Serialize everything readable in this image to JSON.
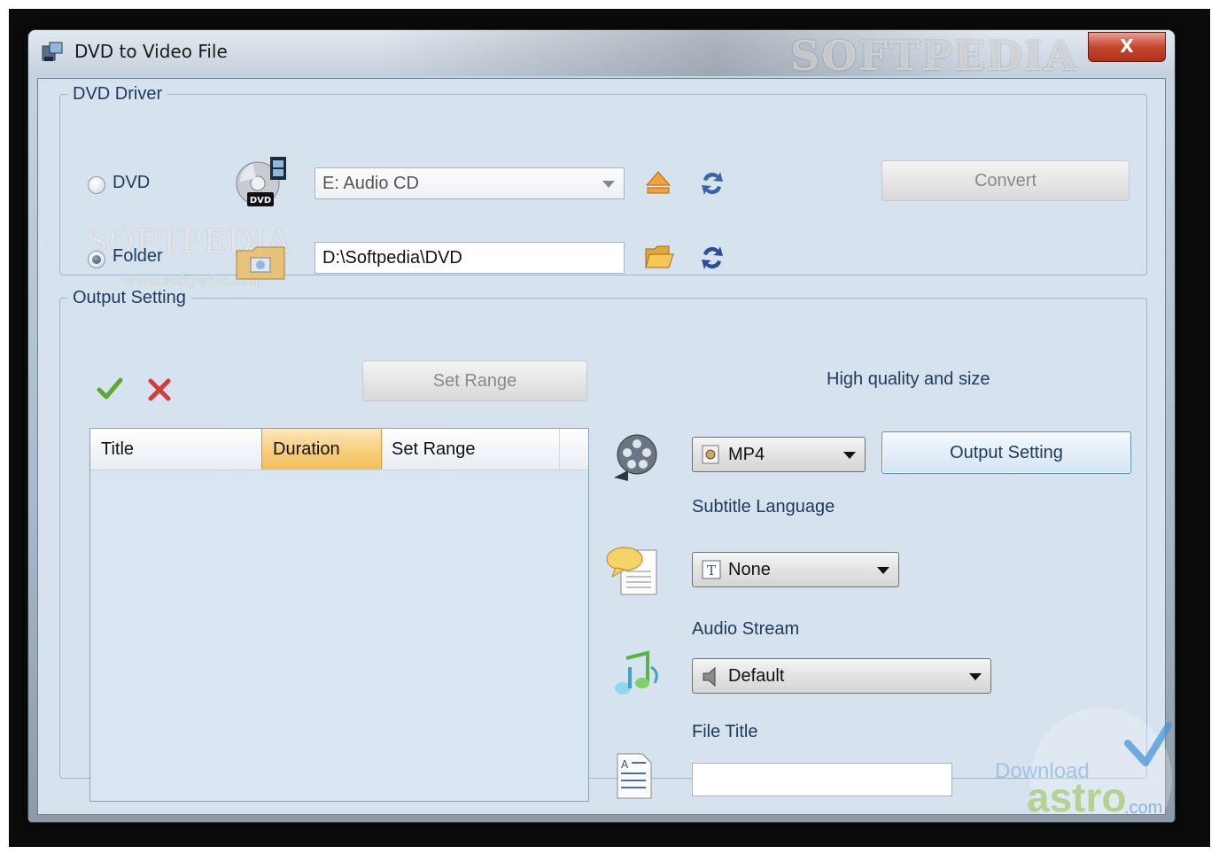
{
  "window": {
    "title": "DVD to Video File",
    "close_glyph": "X",
    "brand_mark": "SOFTPEDIA"
  },
  "dvd_driver": {
    "group_label": "DVD Driver",
    "dvd_radio_label": "DVD",
    "folder_radio_label": "Folder",
    "dvd_selected": false,
    "folder_selected": true,
    "drive_combo_value": "E:  Audio CD",
    "folder_path": "D:\\Softpedia\\DVD",
    "convert_label": "Convert",
    "watermark_top": "SOFTPEDIA",
    "watermark_url": "www.softpedia.com"
  },
  "output_setting": {
    "group_label": "Output Setting",
    "set_range_label": "Set Range",
    "quality_label": "High quality and size",
    "table": {
      "columns": [
        "Title",
        "Duration",
        "Set Range"
      ],
      "rows": []
    },
    "format_value": "MP4",
    "output_setting_label": "Output Setting",
    "subtitle_label": "Subtitle Language",
    "subtitle_value": "None",
    "audio_label": "Audio Stream",
    "audio_value": "Default",
    "file_title_label": "File Title",
    "file_title_value": ""
  },
  "corner_watermark": {
    "line1": "Download",
    "line2": "astro",
    "line3": ".com"
  },
  "colors": {
    "client_bg": "#d6e2ed",
    "group_label": "#1e3a5c",
    "sorted_column": "#f8cf7e",
    "check_green": "#5aa832",
    "cross_red": "#d43c3c"
  }
}
